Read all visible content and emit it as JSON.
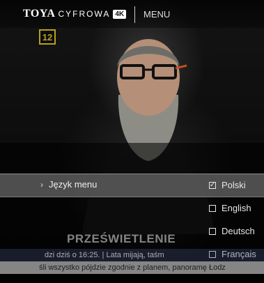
{
  "header": {
    "brand_main": "TOYA",
    "brand_sub": "CYFROWA",
    "brand_badge": "4K",
    "menu_label": "MENU"
  },
  "age_rating": "12",
  "menu": {
    "selected_item": "Język menu"
  },
  "languages": [
    {
      "label": "Polski",
      "checked": true
    },
    {
      "label": "English",
      "checked": false
    },
    {
      "label": "Deutsch",
      "checked": false
    },
    {
      "label": "Français",
      "checked": false
    }
  ],
  "program": {
    "title": "PRZEŚWIETLENIE",
    "ticker_line1": "dzi dziś o 16:25.   |   Lata mijają, taśm",
    "ticker_line2": "śli wszystko pójdzie zgodnie z planem, panoramę Łodz"
  },
  "colors": {
    "age_badge": "#b7a020"
  }
}
